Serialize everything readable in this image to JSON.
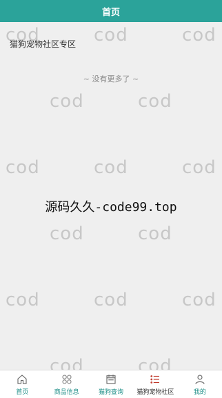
{
  "header": {
    "title": "首页"
  },
  "main": {
    "section_title": "猫狗宠物社区专区",
    "no_more_text": "~ 没有更多了 ~"
  },
  "watermark": {
    "tile_text": "cod",
    "center_text": "源码久久-code99.top"
  },
  "tabbar": {
    "items": [
      {
        "label": "首页",
        "icon": "home-icon"
      },
      {
        "label": "商品信息",
        "icon": "grid-icon"
      },
      {
        "label": "猫狗查询",
        "icon": "calendar-icon"
      },
      {
        "label": "猫狗宠物社区",
        "icon": "list-icon"
      },
      {
        "label": "我的",
        "icon": "user-icon"
      }
    ]
  },
  "colors": {
    "header_bg": "#2ba39a",
    "accent": "#1f8f88",
    "background": "#efefef"
  }
}
